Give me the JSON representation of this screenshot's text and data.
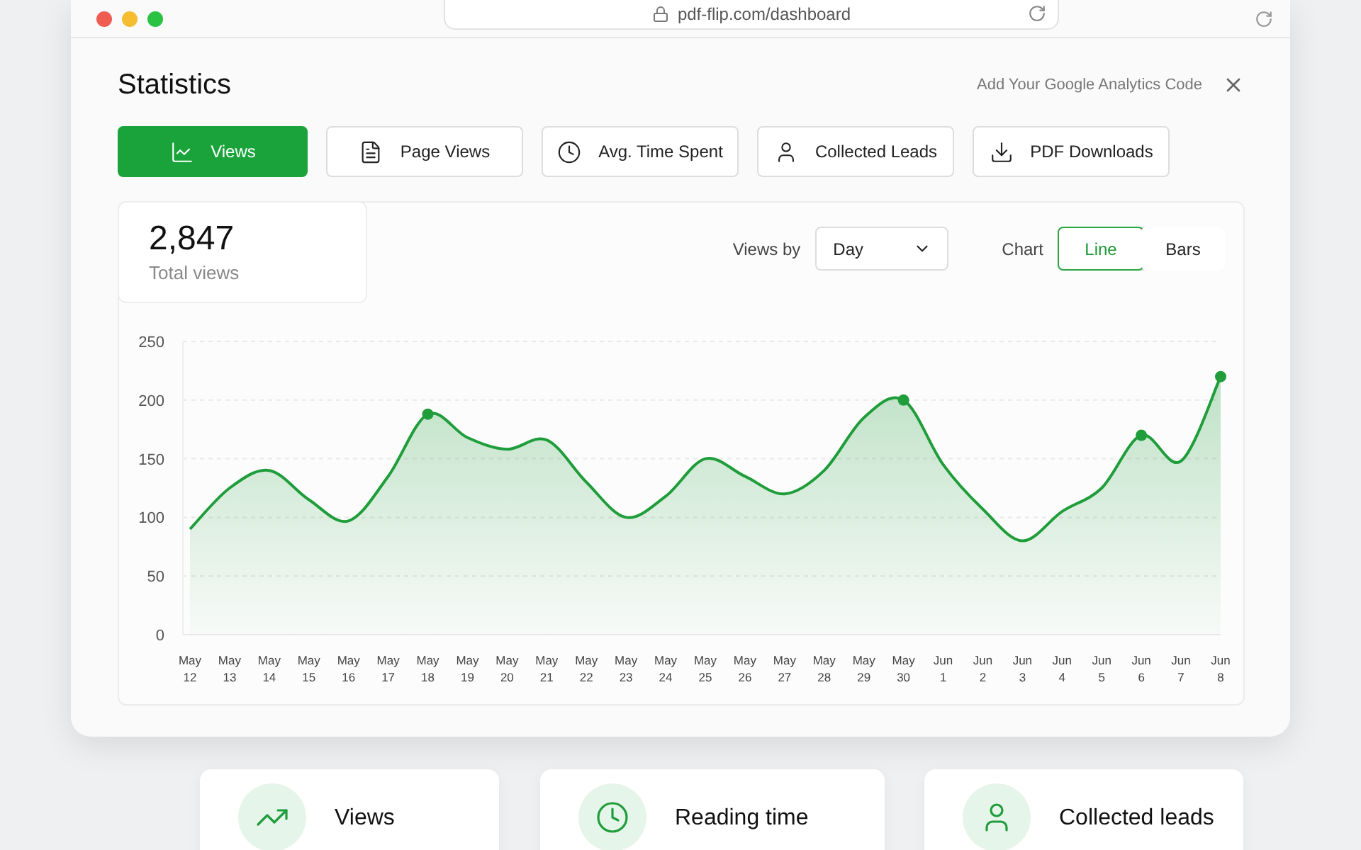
{
  "browser": {
    "url": "pdf-flip.com/dashboard"
  },
  "header": {
    "title": "Statistics",
    "analytics_link": "Add Your Google Analytics Code"
  },
  "tabs": [
    {
      "label": "Views",
      "selected": true
    },
    {
      "label": "Page Views",
      "selected": false
    },
    {
      "label": "Avg. Time Spent",
      "selected": false
    },
    {
      "label": "Collected Leads",
      "selected": false
    },
    {
      "label": "PDF Downloads",
      "selected": false
    }
  ],
  "summary": {
    "value": "2,847",
    "label": "Total views"
  },
  "controls": {
    "views_by_label": "Views by",
    "views_by_value": "Day",
    "chart_label": "Chart",
    "chart_types": [
      {
        "label": "Line",
        "selected": true
      },
      {
        "label": "Bars",
        "selected": false
      }
    ]
  },
  "chart_data": {
    "type": "area",
    "grid": true,
    "categories": [
      "May 12",
      "May 13",
      "May 14",
      "May 15",
      "May 16",
      "May 17",
      "May 18",
      "May 19",
      "May 20",
      "May 21",
      "May 22",
      "May 23",
      "May 24",
      "May 25",
      "May 26",
      "May 27",
      "May 28",
      "May 29",
      "May 30",
      "Jun 1",
      "Jun 2",
      "Jun 3",
      "Jun 4",
      "Jun 5",
      "Jun 6",
      "Jun 7",
      "Jun 8"
    ],
    "series": [
      {
        "color": "#1f9d3a",
        "values": [
          90,
          125,
          140,
          115,
          97,
          135,
          188,
          168,
          158,
          166,
          130,
          100,
          118,
          150,
          135,
          120,
          140,
          185,
          200,
          145,
          107,
          80,
          105,
          125,
          170,
          148,
          220
        ]
      }
    ],
    "ylim": [
      0,
      250
    ],
    "yticks": [
      0,
      50,
      100,
      150,
      200,
      250
    ]
  },
  "cards": [
    {
      "label": "Views"
    },
    {
      "label": "Reading time"
    },
    {
      "label": "Collected leads"
    }
  ]
}
